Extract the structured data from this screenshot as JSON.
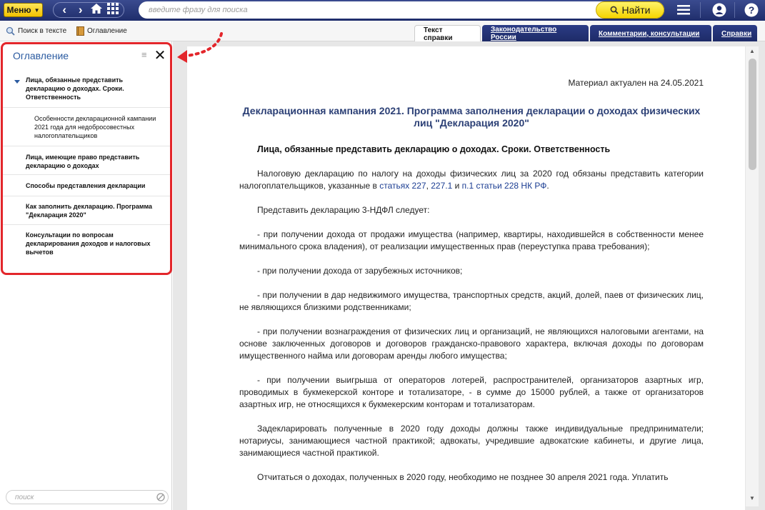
{
  "topbar": {
    "menu_label": "Меню",
    "search_placeholder": "введите фразу для поиска",
    "find_label": "Найти"
  },
  "toolbar": {
    "search_in_text": "Поиск в тексте",
    "toc_label": "Оглавление"
  },
  "tabs": [
    {
      "label": "Текст справки",
      "active": true
    },
    {
      "label": "Законодательство России",
      "active": false
    },
    {
      "label": "Комментарии, консультации",
      "active": false
    },
    {
      "label": "Справки",
      "active": false
    }
  ],
  "toc": {
    "title": "Оглавление",
    "filter_placeholder": "поиск",
    "items": [
      {
        "label": "Лица, обязанные представить декларацию о доходах. Сроки. Ответственность",
        "bold": true,
        "expanded": true,
        "level": 1
      },
      {
        "label": "Особенности декларационной кампании 2021 года для недобросовестных налогоплательщиков",
        "bold": false,
        "level": 2
      },
      {
        "label": "Лица, имеющие право представить декларацию о доходах",
        "bold": true,
        "level": 1
      },
      {
        "label": "Способы представления декларации",
        "bold": true,
        "level": 1
      },
      {
        "label": "Как заполнить декларацию. Программа \"Декларация 2020\"",
        "bold": true,
        "level": 1
      },
      {
        "label": "Консультации по вопросам декларирования доходов и налоговых вычетов",
        "bold": true,
        "level": 1
      }
    ]
  },
  "document": {
    "actual": "Материал актуален на 24.05.2021",
    "title": "Декларационная кампания 2021. Программа заполнения декларации о доходах физических лиц \"Декларация 2020\"",
    "section_heading": "Лица, обязанные представить декларацию о доходах. Сроки. Ответственность",
    "p1_text": "Налоговую декларацию по налогу на доходы физических лиц за 2020 год обязаны представить категории налогоплательщиков, указанные в ",
    "p1_link1": "статьях 227",
    "p1_sep1": ", ",
    "p1_link2": "227.1",
    "p1_sep2": " и ",
    "p1_link3": "п.1 статьи 228",
    "p1_sep3": " ",
    "p1_link4": "НК РФ",
    "p1_end": ".",
    "p2": "Представить декларацию 3-НДФЛ следует:",
    "p3": "- при получении дохода от продажи имущества (например, квартиры, находившейся в собственности менее минимального срока владения), от реализации имущественных прав (переуступка права требования);",
    "p4": "- при получении дохода от зарубежных источников;",
    "p5": "- при получении в дар недвижимого имущества, транспортных средств, акций, долей, паев от физических лиц, не являющихся близкими родственниками;",
    "p6": "- при получении вознаграждения от физических лиц и организаций, не являющихся налоговыми агентами, на основе заключенных договоров и договоров гражданско-правового характера, включая доходы по договорам имущественного найма или договорам аренды любого имущества;",
    "p7": "- при получении выигрыша от операторов лотерей, распространителей, организаторов азартных игр, проводимых в букмекерской конторе и тотализаторе, - в сумме до 15000 рублей, а также от организаторов азартных игр, не относящихся к букмекерским конторам и тотализаторам.",
    "p8": "Задекларировать полученные в 2020 году доходы должны также индивидуальные предприниматели; нотариусы, занимающиеся частной практикой; адвокаты, учредившие адвокатские кабинеты, и другие лица, занимающиеся частной практикой.",
    "p9": "Отчитаться о доходах, полученных в 2020 году, необходимо не позднее 30 апреля 2021 года. Уплатить"
  },
  "colors": {
    "topbar": "#1f2d6b",
    "accent_yellow": "#f5d400",
    "highlight_red": "#e3262b",
    "link_blue": "#1b3d92",
    "title_blue": "#2b3f75"
  },
  "icons": [
    "back-arrow-icon",
    "forward-arrow-icon",
    "home-icon",
    "grid-icon",
    "search-magnifier-icon",
    "hamburger-icon",
    "user-icon",
    "help-icon",
    "book-icon",
    "close-icon",
    "clear-icon"
  ]
}
